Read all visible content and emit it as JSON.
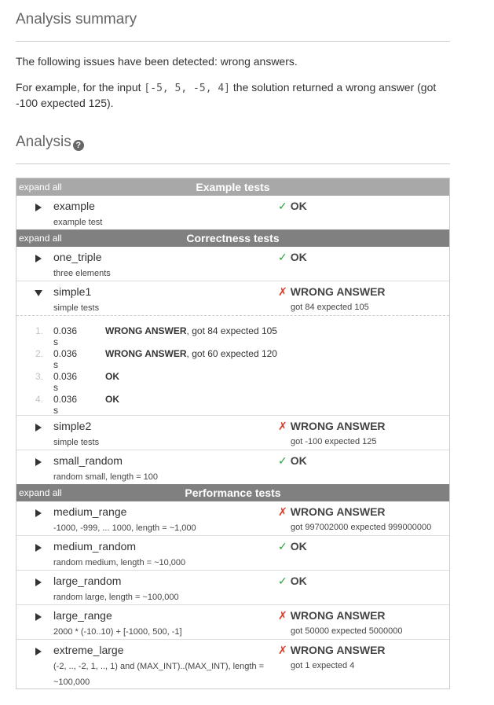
{
  "summary": {
    "heading": "Analysis summary",
    "line1": "The following issues have been detected: wrong answers.",
    "line2_pre": "For example, for the input ",
    "line2_code": "[-5, 5, -5, 4]",
    "line2_post": " the solution returned a wrong answer (got -100 expected 125)."
  },
  "analysis": {
    "heading": "Analysis",
    "help_icon": "?"
  },
  "colors": {
    "ok": "#2aa03c",
    "error": "#d63a2a",
    "header_bg": "#808080",
    "header_first_bg": "#a8a8a8"
  },
  "expand_all_label": "expand all",
  "groups": [
    {
      "title": "Example tests",
      "tests": [
        {
          "name": "example",
          "desc": "example test",
          "status": "OK",
          "ok": true,
          "detail": ""
        }
      ]
    },
    {
      "title": "Correctness tests",
      "tests": [
        {
          "name": "one_triple",
          "desc": "three elements",
          "status": "OK",
          "ok": true,
          "detail": ""
        },
        {
          "name": "simple1",
          "desc": "simple tests",
          "status": "WRONG ANSWER",
          "ok": false,
          "detail": "got 84 expected 105",
          "expanded": true,
          "subtests": [
            {
              "num": "1.",
              "time": "0.036 s",
              "result_bold": "WRONG ANSWER",
              "result_rest": ", got 84 expected 105"
            },
            {
              "num": "2.",
              "time": "0.036 s",
              "result_bold": "WRONG ANSWER",
              "result_rest": ", got 60 expected 120"
            },
            {
              "num": "3.",
              "time": "0.036 s",
              "result_bold": "OK",
              "result_rest": ""
            },
            {
              "num": "4.",
              "time": "0.036 s",
              "result_bold": "OK",
              "result_rest": ""
            }
          ]
        },
        {
          "name": "simple2",
          "desc": "simple tests",
          "status": "WRONG ANSWER",
          "ok": false,
          "detail": "got -100 expected 125"
        },
        {
          "name": "small_random",
          "desc": "random small, length = 100",
          "status": "OK",
          "ok": true,
          "detail": ""
        }
      ]
    },
    {
      "title": "Performance tests",
      "tests": [
        {
          "name": "medium_range",
          "desc": "-1000, -999, ... 1000, length = ~1,000",
          "status": "WRONG ANSWER",
          "ok": false,
          "detail": "got 997002000 expected 999000000"
        },
        {
          "name": "medium_random",
          "desc": "random medium, length = ~10,000",
          "status": "OK",
          "ok": true,
          "detail": ""
        },
        {
          "name": "large_random",
          "desc": "random large, length = ~100,000",
          "status": "OK",
          "ok": true,
          "detail": ""
        },
        {
          "name": "large_range",
          "desc": "2000 * (-10..10) + [-1000, 500, -1]",
          "status": "WRONG ANSWER",
          "ok": false,
          "detail": "got 50000 expected 5000000"
        },
        {
          "name": "extreme_large",
          "desc": "(-2, .., -2, 1, .., 1) and (MAX_INT)..(MAX_INT), length = ~100,000",
          "status": "WRONG ANSWER",
          "ok": false,
          "detail": "got 1 expected 4",
          "tall": true
        }
      ]
    }
  ]
}
